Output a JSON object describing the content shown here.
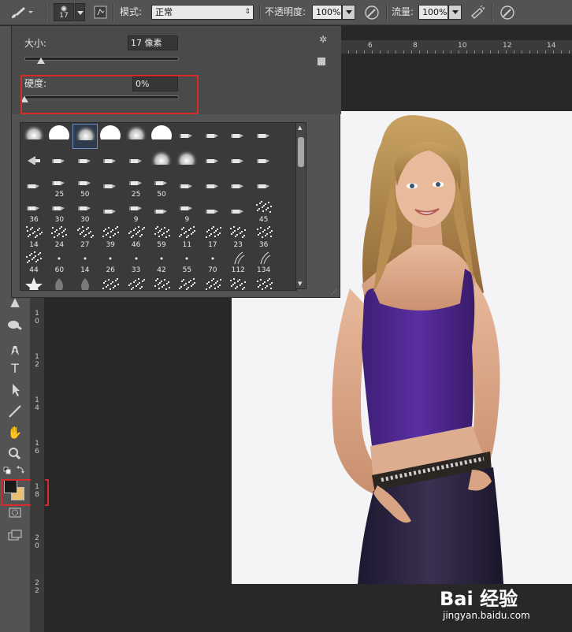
{
  "options_bar": {
    "brush_size": "17",
    "mode_label": "模式:",
    "mode_value": "正常",
    "opacity_label": "不透明度:",
    "opacity_value": "100%",
    "flow_label": "流量:",
    "flow_value": "100%"
  },
  "brush_popup": {
    "size_label": "大小:",
    "size_value": "17 像素",
    "size_slider_fraction": 0.11,
    "hardness_label": "硬度:",
    "hardness_value": "0%",
    "hardness_slider_fraction": 0.0,
    "presets": [
      {
        "label": "",
        "kind": "soft"
      },
      {
        "label": "",
        "kind": "hard"
      },
      {
        "label": "",
        "kind": "soft-selected"
      },
      {
        "label": "",
        "kind": "hard"
      },
      {
        "label": "",
        "kind": "soft"
      },
      {
        "label": "",
        "kind": "hard"
      },
      {
        "label": "",
        "kind": "tip"
      },
      {
        "label": "",
        "kind": "tip"
      },
      {
        "label": "",
        "kind": "tip"
      },
      {
        "label": "",
        "kind": "tip"
      },
      {
        "label": "",
        "kind": "fan"
      },
      {
        "label": "",
        "kind": "tip"
      },
      {
        "label": "",
        "kind": "tip"
      },
      {
        "label": "",
        "kind": "tip"
      },
      {
        "label": "",
        "kind": "tip"
      },
      {
        "label": "",
        "kind": "soft"
      },
      {
        "label": "",
        "kind": "soft"
      },
      {
        "label": "",
        "kind": "tip"
      },
      {
        "label": "",
        "kind": "tip"
      },
      {
        "label": "",
        "kind": "tip"
      },
      {
        "label": "",
        "kind": "tip"
      },
      {
        "label": "25",
        "kind": "tip"
      },
      {
        "label": "50",
        "kind": "tip"
      },
      {
        "label": "",
        "kind": "tip"
      },
      {
        "label": "25",
        "kind": "tip"
      },
      {
        "label": "50",
        "kind": "tip"
      },
      {
        "label": "",
        "kind": "tip"
      },
      {
        "label": "",
        "kind": "tip"
      },
      {
        "label": "",
        "kind": "tip"
      },
      {
        "label": "",
        "kind": "tip"
      },
      {
        "label": "36",
        "kind": "tip"
      },
      {
        "label": "30",
        "kind": "tip"
      },
      {
        "label": "30",
        "kind": "tip"
      },
      {
        "label": "",
        "kind": "tip"
      },
      {
        "label": "9",
        "kind": "tip"
      },
      {
        "label": "",
        "kind": "tip"
      },
      {
        "label": "9",
        "kind": "tip"
      },
      {
        "label": "",
        "kind": "tip"
      },
      {
        "label": "",
        "kind": "tip"
      },
      {
        "label": "45",
        "kind": "scatter"
      },
      {
        "label": "14",
        "kind": "scatter"
      },
      {
        "label": "24",
        "kind": "scatter"
      },
      {
        "label": "27",
        "kind": "scatter"
      },
      {
        "label": "39",
        "kind": "scatter"
      },
      {
        "label": "46",
        "kind": "scatter"
      },
      {
        "label": "59",
        "kind": "scatter"
      },
      {
        "label": "11",
        "kind": "scatter"
      },
      {
        "label": "17",
        "kind": "scatter"
      },
      {
        "label": "23",
        "kind": "scatter"
      },
      {
        "label": "36",
        "kind": "scatter"
      },
      {
        "label": "44",
        "kind": "scatter"
      },
      {
        "label": "60",
        "kind": "dot"
      },
      {
        "label": "14",
        "kind": "dot"
      },
      {
        "label": "26",
        "kind": "dot"
      },
      {
        "label": "33",
        "kind": "dot"
      },
      {
        "label": "42",
        "kind": "dot"
      },
      {
        "label": "55",
        "kind": "dot"
      },
      {
        "label": "70",
        "kind": "dot"
      },
      {
        "label": "112",
        "kind": "grass"
      },
      {
        "label": "134",
        "kind": "grass"
      },
      {
        "label": "",
        "kind": "star"
      },
      {
        "label": "",
        "kind": "leaf"
      },
      {
        "label": "",
        "kind": "leaf"
      },
      {
        "label": "",
        "kind": "scatter"
      },
      {
        "label": "",
        "kind": "scatter"
      },
      {
        "label": "",
        "kind": "scatter"
      },
      {
        "label": "",
        "kind": "scatter"
      },
      {
        "label": "",
        "kind": "scatter"
      },
      {
        "label": "",
        "kind": "scatter"
      },
      {
        "label": "",
        "kind": "scatter"
      }
    ]
  },
  "h_ruler": [
    "6",
    "8",
    "10",
    "12",
    "14"
  ],
  "v_ruler": [
    "1\n0",
    "1\n2",
    "1\n4",
    "1\n6",
    "1\n8",
    "2\n0",
    "2\n2"
  ],
  "colors": {
    "foreground": "#1a1a1a",
    "background": "#e8c074",
    "highlight": "#d72b2b",
    "top_color": "#4a2a8a"
  },
  "watermark": {
    "brand": "Bai 经验",
    "url": "jingyan.baidu.com"
  }
}
